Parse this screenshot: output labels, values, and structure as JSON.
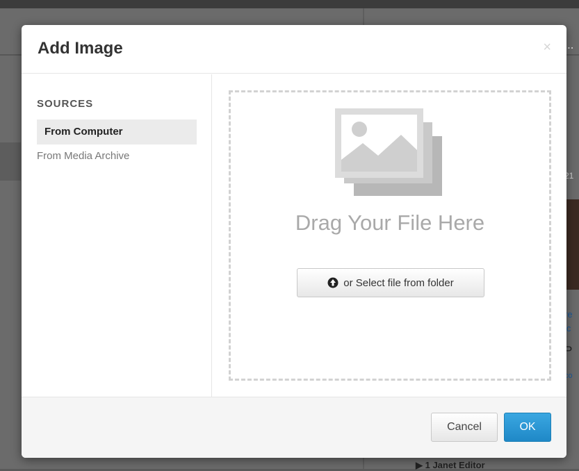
{
  "background": {
    "fragment_a": "...",
    "fragment_b": "21",
    "fragment_c": "re",
    "fragment_d": "ic",
    "fragment_e": "P",
    "fragment_f": "co",
    "bottom_text": "▶ 1      Janet Editor"
  },
  "dialog": {
    "title": "Add Image",
    "close_glyph": "×"
  },
  "sidebar": {
    "heading": "SOURCES",
    "items": [
      {
        "label": "From Computer",
        "active": true
      },
      {
        "label": "From Media Archive",
        "active": false
      }
    ]
  },
  "dropzone": {
    "icon": "image-stack-icon",
    "text": "Drag Your File Here",
    "button_icon": "upload-circle-icon",
    "button_label": "or Select file from folder"
  },
  "footer": {
    "cancel_label": "Cancel",
    "ok_label": "OK"
  },
  "colors": {
    "ok_button": "#2a96d4",
    "overlay": "#6b6b6b"
  }
}
